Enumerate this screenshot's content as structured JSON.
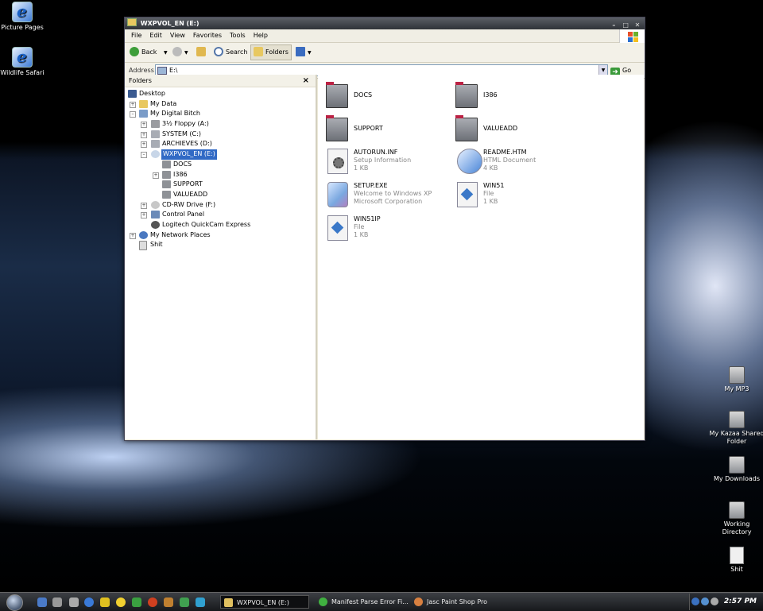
{
  "desktop": {
    "icons_left": [
      {
        "label": "Picture Pages"
      },
      {
        "label": "Wildlife Safari"
      }
    ],
    "icons_right": [
      {
        "label": "My MP3"
      },
      {
        "label": "My Kazaa Shared Folder"
      },
      {
        "label": "My Downloads"
      },
      {
        "label": "Working Directory"
      },
      {
        "label": "Shit"
      }
    ]
  },
  "window": {
    "title": "WXPVOL_EN (E:)",
    "controls": {
      "minimize": "–",
      "maximize": "□",
      "close": "✕"
    },
    "menu": [
      "File",
      "Edit",
      "View",
      "Favorites",
      "Tools",
      "Help"
    ],
    "toolbar": {
      "back": "Back",
      "search": "Search",
      "folders": "Folders"
    },
    "address": {
      "label": "Address",
      "value": "E:\\",
      "go": "Go"
    },
    "folders_pane": {
      "title": "Folders",
      "close": "×",
      "tree": [
        {
          "label": "Desktop",
          "expander": ""
        },
        {
          "label": "My Data",
          "expander": "+"
        },
        {
          "label": "My Digital Bitch",
          "expander": "–"
        },
        {
          "label": "3½ Floppy (A:)",
          "expander": "+"
        },
        {
          "label": "SYSTEM (C:)",
          "expander": "+"
        },
        {
          "label": "ARCHIEVES (D:)",
          "expander": "+"
        },
        {
          "label": "WXPVOL_EN (E:)",
          "expander": "–"
        },
        {
          "label": "DOCS",
          "expander": ""
        },
        {
          "label": "I386",
          "expander": "+"
        },
        {
          "label": "SUPPORT",
          "expander": ""
        },
        {
          "label": "VALUEADD",
          "expander": ""
        },
        {
          "label": "CD-RW Drive (F:)",
          "expander": "+"
        },
        {
          "label": "Control Panel",
          "expander": "+"
        },
        {
          "label": "Logitech QuickCam Express",
          "expander": ""
        },
        {
          "label": "My Network Places",
          "expander": "+"
        },
        {
          "label": "Shit",
          "expander": ""
        }
      ]
    },
    "files": [
      {
        "name": "DOCS",
        "line1": "",
        "line2": ""
      },
      {
        "name": "I386",
        "line1": "",
        "line2": ""
      },
      {
        "name": "SUPPORT",
        "line1": "",
        "line2": ""
      },
      {
        "name": "VALUEADD",
        "line1": "",
        "line2": ""
      },
      {
        "name": "AUTORUN.INF",
        "line1": "Setup Information",
        "line2": "1 KB"
      },
      {
        "name": "README.HTM",
        "line1": "HTML Document",
        "line2": "4 KB"
      },
      {
        "name": "SETUP.EXE",
        "line1": "Welcome to Windows XP",
        "line2": "Microsoft Corporation"
      },
      {
        "name": "WIN51",
        "line1": "File",
        "line2": "1 KB"
      },
      {
        "name": "WIN51IP",
        "line1": "File",
        "line2": "1 KB"
      }
    ]
  },
  "taskbar": {
    "tasks": [
      "WXPVOL_EN (E:)",
      "Manifest Parse Error Fi...",
      "Jasc Paint Shop Pro"
    ],
    "clock": "2:57 PM"
  }
}
